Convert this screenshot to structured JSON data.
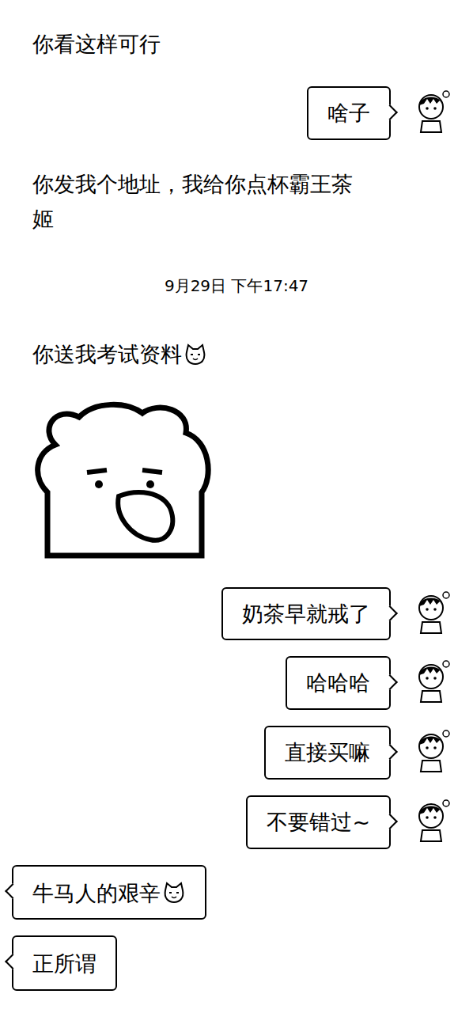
{
  "messages": [
    {
      "kind": "text",
      "side": "left",
      "text": "你看这样可行",
      "emoji": false,
      "bordered": false
    },
    {
      "kind": "text",
      "side": "right",
      "text": "啥子",
      "emoji": false,
      "bordered": true
    },
    {
      "kind": "text",
      "side": "left",
      "text": "你发我个地址，我给你点杯霸王茶姬",
      "emoji": false,
      "bordered": false
    },
    {
      "kind": "time",
      "side": "center",
      "text": "9月29日 下午17:47",
      "emoji": false,
      "bordered": false
    },
    {
      "kind": "text",
      "side": "left",
      "text": "你送我考试资料",
      "emoji": true,
      "bordered": false
    },
    {
      "kind": "sticker",
      "side": "left",
      "text": "",
      "emoji": false,
      "bordered": false
    },
    {
      "kind": "text",
      "side": "right",
      "text": "奶茶早就戒了",
      "emoji": false,
      "bordered": true
    },
    {
      "kind": "text",
      "side": "right",
      "text": "哈哈哈",
      "emoji": false,
      "bordered": true
    },
    {
      "kind": "text",
      "side": "right",
      "text": "直接买嘛",
      "emoji": false,
      "bordered": true
    },
    {
      "kind": "text",
      "side": "right",
      "text": "不要错过~",
      "emoji": false,
      "bordered": true
    },
    {
      "kind": "text",
      "side": "left",
      "text": "牛马人的艰辛",
      "emoji": true,
      "bordered": true
    },
    {
      "kind": "text",
      "side": "left",
      "text": "正所谓",
      "emoji": false,
      "bordered": true
    }
  ]
}
